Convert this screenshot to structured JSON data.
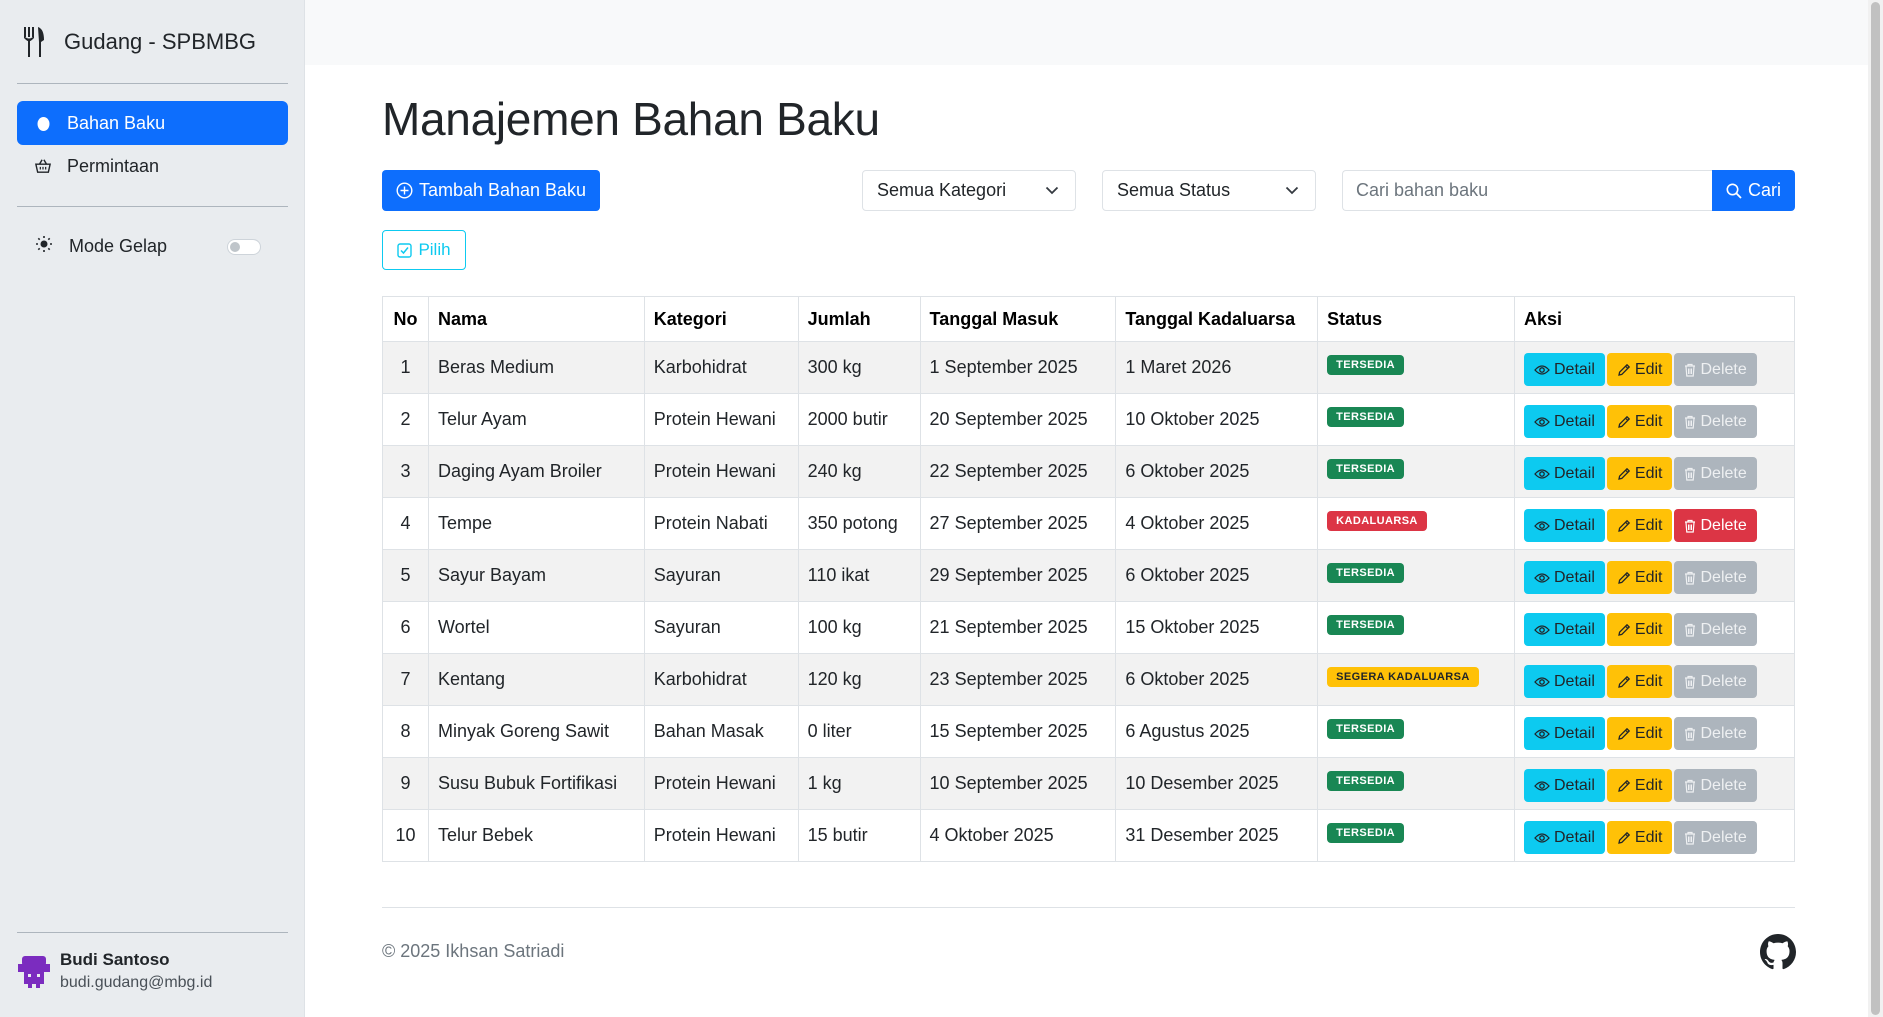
{
  "sidebar": {
    "brand": "Gudang - SPBMBG",
    "brand_icon": "utensils-icon",
    "items": [
      {
        "label": "Bahan Baku",
        "icon": "egg-icon",
        "active": true
      },
      {
        "label": "Permintaan",
        "icon": "basket-icon",
        "active": false
      }
    ],
    "dark_mode": {
      "label": "Mode Gelap",
      "icon": "sun-icon",
      "enabled": false
    },
    "user": {
      "name": "Budi Santoso",
      "email": "budi.gudang@mbg.id"
    }
  },
  "main": {
    "title": "Manajemen Bahan Baku",
    "add_button": "Tambah Bahan Baku",
    "select_button": "Pilih",
    "category_filter": "Semua Kategori",
    "status_filter": "Semua Status",
    "search_placeholder": "Cari bahan baku",
    "search_button": "Cari"
  },
  "table": {
    "headers": [
      "No",
      "Nama",
      "Kategori",
      "Jumlah",
      "Tanggal Masuk",
      "Tanggal Kadaluarsa",
      "Status",
      "Aksi"
    ],
    "actions": {
      "detail": "Detail",
      "edit": "Edit",
      "delete": "Delete"
    },
    "rows": [
      {
        "no": "1",
        "nama": "Beras Medium",
        "kategori": "Karbohidrat",
        "jumlah": "300 kg",
        "masuk": "1 September 2025",
        "kadaluarsa": "1 Maret 2026",
        "status": "TERSEDIA",
        "status_type": "success",
        "delete_enabled": false
      },
      {
        "no": "2",
        "nama": "Telur Ayam",
        "kategori": "Protein Hewani",
        "jumlah": "2000 butir",
        "masuk": "20 September 2025",
        "kadaluarsa": "10 Oktober 2025",
        "status": "TERSEDIA",
        "status_type": "success",
        "delete_enabled": false
      },
      {
        "no": "3",
        "nama": "Daging Ayam Broiler",
        "kategori": "Protein Hewani",
        "jumlah": "240 kg",
        "masuk": "22 September 2025",
        "kadaluarsa": "6 Oktober 2025",
        "status": "TERSEDIA",
        "status_type": "success",
        "delete_enabled": false
      },
      {
        "no": "4",
        "nama": "Tempe",
        "kategori": "Protein Nabati",
        "jumlah": "350 potong",
        "masuk": "27 September 2025",
        "kadaluarsa": "4 Oktober 2025",
        "status": "KADALUARSA",
        "status_type": "danger",
        "delete_enabled": true
      },
      {
        "no": "5",
        "nama": "Sayur Bayam",
        "kategori": "Sayuran",
        "jumlah": "110 ikat",
        "masuk": "29 September 2025",
        "kadaluarsa": "6 Oktober 2025",
        "status": "TERSEDIA",
        "status_type": "success",
        "delete_enabled": false
      },
      {
        "no": "6",
        "nama": "Wortel",
        "kategori": "Sayuran",
        "jumlah": "100 kg",
        "masuk": "21 September 2025",
        "kadaluarsa": "15 Oktober 2025",
        "status": "TERSEDIA",
        "status_type": "success",
        "delete_enabled": false
      },
      {
        "no": "7",
        "nama": "Kentang",
        "kategori": "Karbohidrat",
        "jumlah": "120 kg",
        "masuk": "23 September 2025",
        "kadaluarsa": "6 Oktober 2025",
        "status": "SEGERA KADALUARSA",
        "status_type": "warning",
        "delete_enabled": false
      },
      {
        "no": "8",
        "nama": "Minyak Goreng Sawit",
        "kategori": "Bahan Masak",
        "jumlah": "0 liter",
        "masuk": "15 September 2025",
        "kadaluarsa": "6 Agustus 2025",
        "status": "TERSEDIA",
        "status_type": "success",
        "delete_enabled": false
      },
      {
        "no": "9",
        "nama": "Susu Bubuk Fortifikasi",
        "kategori": "Protein Hewani",
        "jumlah": "1 kg",
        "masuk": "10 September 2025",
        "kadaluarsa": "10 Desember 2025",
        "status": "TERSEDIA",
        "status_type": "success",
        "delete_enabled": false
      },
      {
        "no": "10",
        "nama": "Telur Bebek",
        "kategori": "Protein Hewani",
        "jumlah": "15 butir",
        "masuk": "4 Oktober 2025",
        "kadaluarsa": "31 Desember 2025",
        "status": "TERSEDIA",
        "status_type": "success",
        "delete_enabled": false
      }
    ]
  },
  "footer": {
    "copyright": "© 2025 Ikhsan Satriadi",
    "icon": "github-icon"
  },
  "colors": {
    "primary": "#0d6efd",
    "info": "#0dcaf0",
    "warning": "#ffc107",
    "danger": "#dc3545",
    "success": "#198754",
    "secondary": "#adb5bd"
  }
}
